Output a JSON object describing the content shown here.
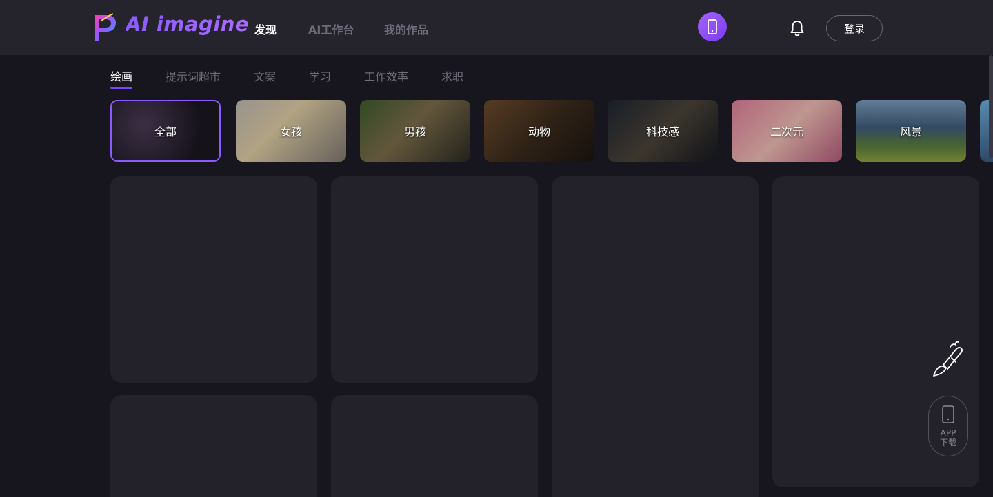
{
  "brand": {
    "name": "AI imagine"
  },
  "nav": [
    {
      "label": "发现",
      "active": true
    },
    {
      "label": "AI工作台",
      "active": false
    },
    {
      "label": "我的作品",
      "active": false
    }
  ],
  "header": {
    "login_label": "登录",
    "phone_icon": "smartphone-icon",
    "bell_icon": "bell-icon"
  },
  "subtabs": [
    {
      "label": "绘画",
      "active": true
    },
    {
      "label": "提示词超市"
    },
    {
      "label": "文案"
    },
    {
      "label": "学习"
    },
    {
      "label": "工作效率"
    },
    {
      "label": "求职"
    }
  ],
  "categories": [
    {
      "label": "全部",
      "active": true
    },
    {
      "label": "女孩"
    },
    {
      "label": "男孩"
    },
    {
      "label": "动物"
    },
    {
      "label": "科技感"
    },
    {
      "label": "二次元"
    },
    {
      "label": "风景"
    }
  ],
  "floating": {
    "app_line1": "APP",
    "app_line2": "下载"
  },
  "colors": {
    "accent": "#7b47f5",
    "bg": "#17151e",
    "topbar": "#25232c",
    "card": "#23222b"
  }
}
